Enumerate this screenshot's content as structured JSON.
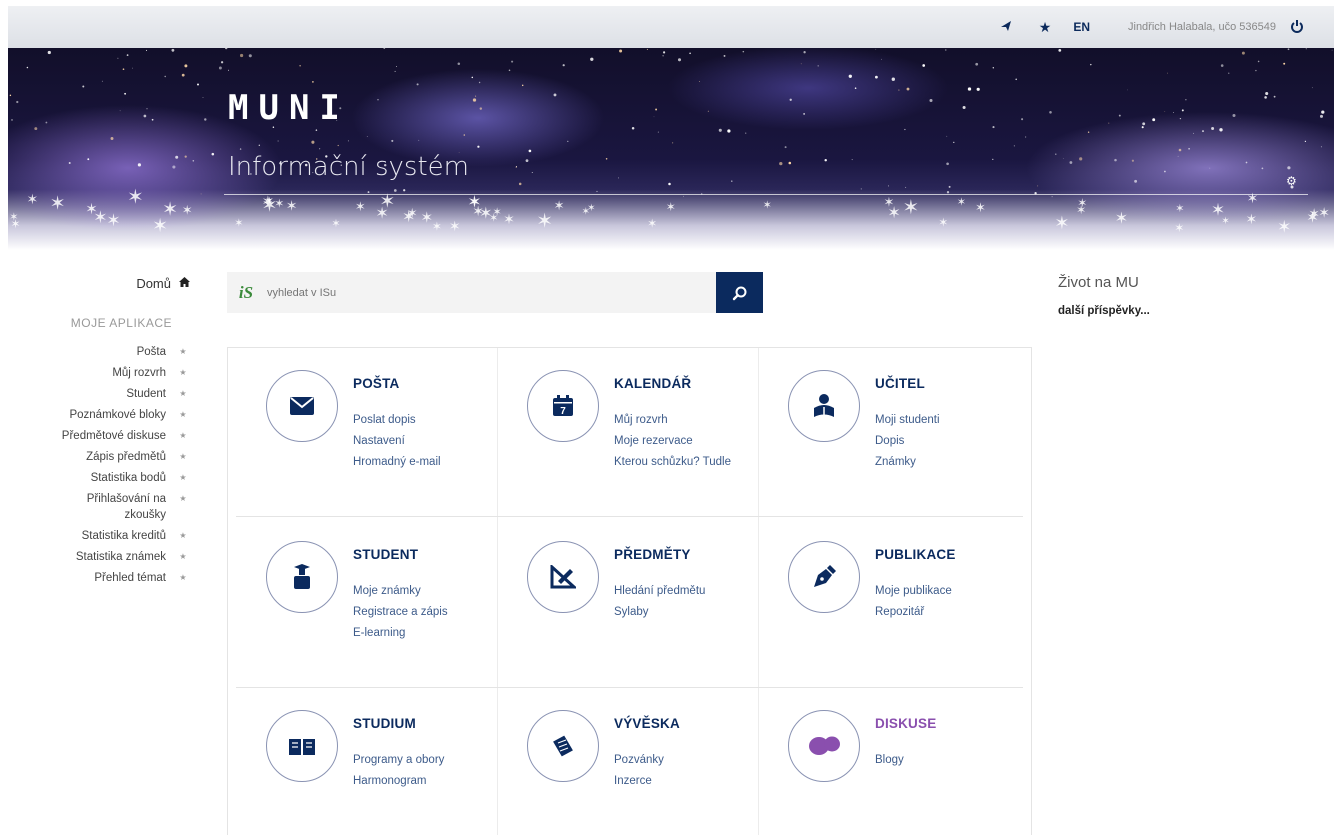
{
  "topbar": {
    "nav_icon": "navigation-icon",
    "star_icon": "star-icon",
    "lang_label": "EN",
    "user_label": "Jindřich Halabala, učo 536549",
    "power_icon": "power-icon"
  },
  "banner": {
    "logo_text": "MUNI",
    "subtitle": "Informační systém",
    "settings_icon": "gear-icon"
  },
  "sidebar": {
    "home_label": "Domů",
    "apps_heading": "MOJE APLIKACE",
    "items": [
      {
        "label": "Pošta"
      },
      {
        "label": "Můj rozvrh"
      },
      {
        "label": "Student"
      },
      {
        "label": "Poznámkové bloky"
      },
      {
        "label": "Předmětové diskuse"
      },
      {
        "label": "Zápis předmětů"
      },
      {
        "label": "Statistika bodů"
      },
      {
        "label": "Přihlašování na zkoušky"
      },
      {
        "label": "Statistika kreditů"
      },
      {
        "label": "Statistika známek"
      },
      {
        "label": "Přehled témat"
      }
    ]
  },
  "search": {
    "logo": "iS",
    "placeholder": "vyhledat v ISu"
  },
  "tiles": [
    {
      "title": "POŠTA",
      "icon": "envelope-icon",
      "color": "#0b2a5e",
      "links": [
        "Poslat dopis",
        "Nastavení",
        "Hromadný e-mail"
      ]
    },
    {
      "title": "KALENDÁŘ",
      "icon": "calendar-icon",
      "color": "#0b2a5e",
      "links": [
        "Můj rozvrh",
        "Moje rezervace",
        "Kterou schůzku? Tudle"
      ]
    },
    {
      "title": "UČITEL",
      "icon": "teacher-icon",
      "color": "#0b2a5e",
      "links": [
        "Moji studenti",
        "Dopis",
        "Známky"
      ]
    },
    {
      "title": "STUDENT",
      "icon": "student-icon",
      "color": "#0b2a5e",
      "links": [
        "Moje známky",
        "Registrace a zápis",
        "E-learning"
      ]
    },
    {
      "title": "PŘEDMĚTY",
      "icon": "ruler-pencil-icon",
      "color": "#0b2a5e",
      "links": [
        "Hledání předmětu",
        "Sylaby"
      ]
    },
    {
      "title": "PUBLIKACE",
      "icon": "pen-nib-icon",
      "color": "#0b2a5e",
      "links": [
        "Moje publikace",
        "Repozitář"
      ]
    },
    {
      "title": "STUDIUM",
      "icon": "book-icon",
      "color": "#0b2a5e",
      "links": [
        "Programy a obory",
        "Harmonogram"
      ]
    },
    {
      "title": "VÝVĚSKA",
      "icon": "notes-icon",
      "color": "#0b2a5e",
      "links": [
        "Pozvánky",
        "Inzerce"
      ]
    },
    {
      "title": "DISKUSE",
      "icon": "chat-bubbles-icon",
      "color": "#8a4fae",
      "links": [
        "Blogy"
      ]
    }
  ],
  "right": {
    "heading": "Život na MU",
    "more_label": "další příspěvky..."
  }
}
